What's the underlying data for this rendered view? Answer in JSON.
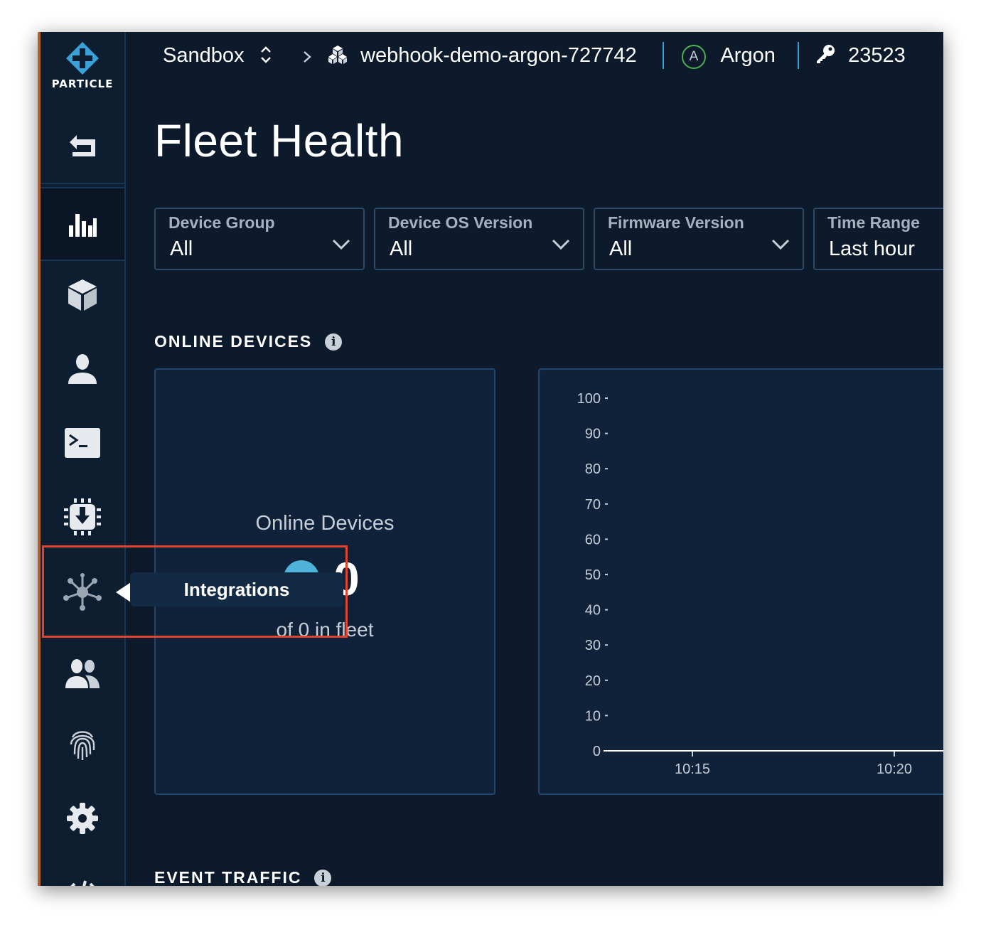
{
  "brand": {
    "logo_text": "PARTICLE",
    "accent": "#3aa0d8"
  },
  "sidebar": {
    "items": [
      {
        "icon": "back-arrow-icon"
      },
      {
        "icon": "bar-chart-icon",
        "active": true
      },
      {
        "icon": "cube-icon"
      },
      {
        "icon": "user-icon"
      },
      {
        "icon": "terminal-icon"
      },
      {
        "icon": "firmware-chip-icon"
      },
      {
        "icon": "integrations-icon",
        "tooltip": "Integrations"
      },
      {
        "icon": "team-icon"
      },
      {
        "icon": "fingerprint-icon"
      },
      {
        "icon": "gear-icon"
      },
      {
        "icon": "code-icon"
      }
    ]
  },
  "header": {
    "org": "Sandbox",
    "product": "webhook-demo-argon-727742",
    "device_type_badge": "A",
    "device_type": "Argon",
    "product_id": "23523"
  },
  "page": {
    "title": "Fleet Health"
  },
  "filters": [
    {
      "label": "Device Group",
      "value": "All"
    },
    {
      "label": "Device OS Version",
      "value": "All"
    },
    {
      "label": "Firmware Version",
      "value": "All"
    },
    {
      "label": "Time Range",
      "value": "Last hour"
    }
  ],
  "online_section": {
    "heading": "ONLINE DEVICES",
    "card_label": "Online Devices",
    "count": "0",
    "fleet_text": "of 0 in fleet"
  },
  "event_section": {
    "heading": "EVENT TRAFFIC"
  },
  "tooltip": {
    "text": "Integrations"
  },
  "chart_data": {
    "type": "line",
    "title": "",
    "xlabel": "",
    "ylabel": "",
    "ylim": [
      0,
      100
    ],
    "y_ticks": [
      0,
      10,
      20,
      30,
      40,
      50,
      60,
      70,
      80,
      90,
      100
    ],
    "x_ticks": [
      "10:15",
      "10:20"
    ],
    "series": [
      {
        "values": [
          0,
          0
        ]
      }
    ]
  }
}
